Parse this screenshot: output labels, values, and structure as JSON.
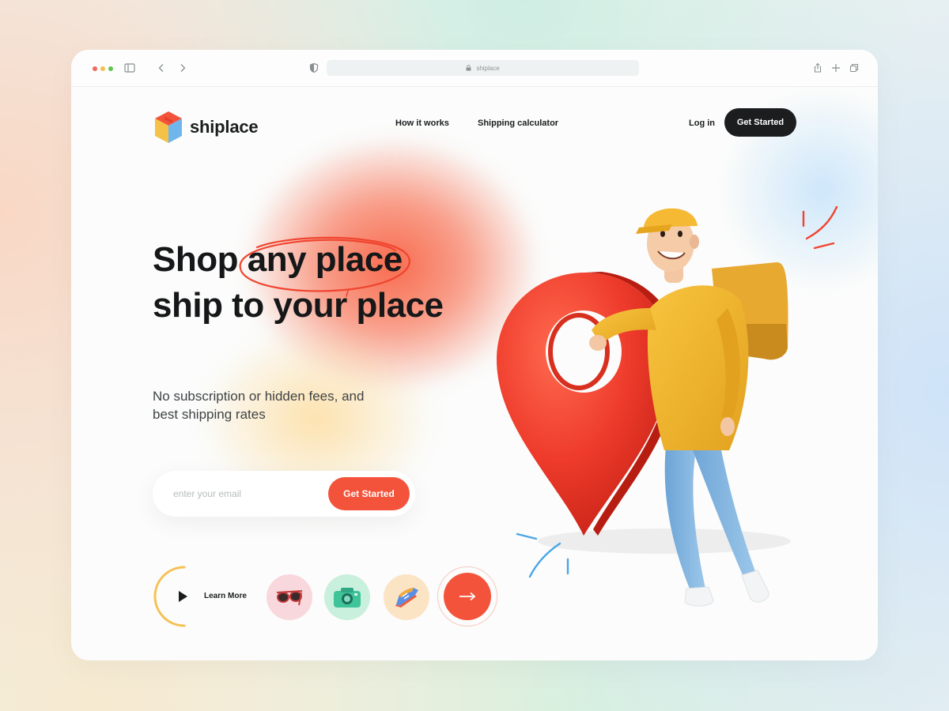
{
  "browser": {
    "url": "shiplace"
  },
  "header": {
    "logo_text": "shiplace",
    "nav": [
      "How it works",
      "Shipping calculator"
    ],
    "login_label": "Log in",
    "cta_label": "Get Started"
  },
  "hero": {
    "headline_line1_a": "Shop",
    "headline_line1_b": "any place",
    "headline_line2": "ship to your place",
    "subtext": "No subscription or hidden fees, and best shipping rates",
    "email_placeholder": "enter your email",
    "email_cta_label": "Get Started",
    "learn_more_label": "Learn More"
  },
  "products": [
    {
      "icon": "sunglasses-icon"
    },
    {
      "icon": "camera-icon"
    },
    {
      "icon": "sneaker-icon"
    }
  ],
  "colors": {
    "accent_orange": "#f4533b",
    "dark": "#1b1d1e",
    "pin_red": "#ee3b2b",
    "courier_yellow": "#f6b933",
    "jeans_blue": "#7fb3df"
  }
}
